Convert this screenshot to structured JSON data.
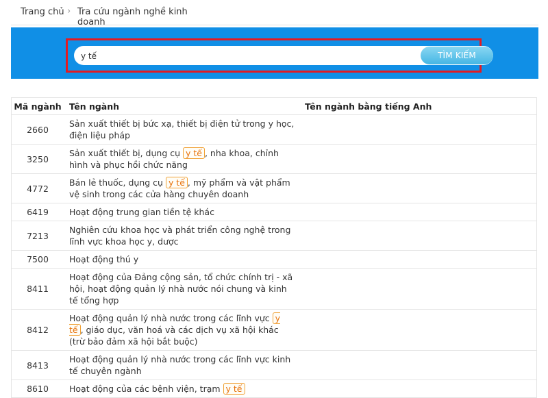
{
  "breadcrumb": {
    "home": "Trang chủ",
    "separator": "›",
    "current": "Tra cứu ngành nghề kinh doanh"
  },
  "search": {
    "value": "y tế",
    "button_label": "TÌM KIẾM"
  },
  "table": {
    "headers": [
      "Mã ngành",
      "Tên ngành",
      "Tên ngành bằng tiếng Anh"
    ],
    "highlight_term": "y tế",
    "rows": [
      {
        "code": "2660",
        "name": "Sản xuất thiết bị bức xạ, thiết bị điện tử trong y học, điện liệu pháp",
        "english": ""
      },
      {
        "code": "3250",
        "name": "Sản xuất thiết bị, dụng cụ y tế, nha khoa, chỉnh hình và phục hồi chức năng",
        "english": ""
      },
      {
        "code": "4772",
        "name": "Bán lẻ thuốc, dụng cụ y tế, mỹ phẩm và vật phẩm vệ sinh trong các cửa hàng chuyên doanh",
        "english": ""
      },
      {
        "code": "6419",
        "name": "Hoạt động trung gian tiền tệ khác",
        "english": ""
      },
      {
        "code": "7213",
        "name": "Nghiên cứu khoa học và phát triển công nghệ trong lĩnh vực khoa học y, dược",
        "english": ""
      },
      {
        "code": "7500",
        "name": "Hoạt động thú y",
        "english": ""
      },
      {
        "code": "8411",
        "name": "Hoạt động của Đảng cộng sản, tổ chức chính trị - xã hội, hoạt động quản lý nhà nước nói chung và kinh tế tổng hợp",
        "english": ""
      },
      {
        "code": "8412",
        "name": "Hoạt động quản lý nhà nước trong các lĩnh vực y tế, giáo dục, văn hoá và các dịch vụ xã hội khác (trừ bảo đảm xã hội bắt buộc)",
        "english": ""
      },
      {
        "code": "8413",
        "name": "Hoạt động quản lý nhà nước trong các lĩnh vực kinh tế chuyên ngành",
        "english": ""
      },
      {
        "code": "8610",
        "name": "Hoạt động của các bệnh viện, trạm y tế",
        "english": ""
      }
    ]
  },
  "colors": {
    "band": "#108fe6",
    "highlight_frame": "#e31b23",
    "match_text": "#e8730c"
  }
}
